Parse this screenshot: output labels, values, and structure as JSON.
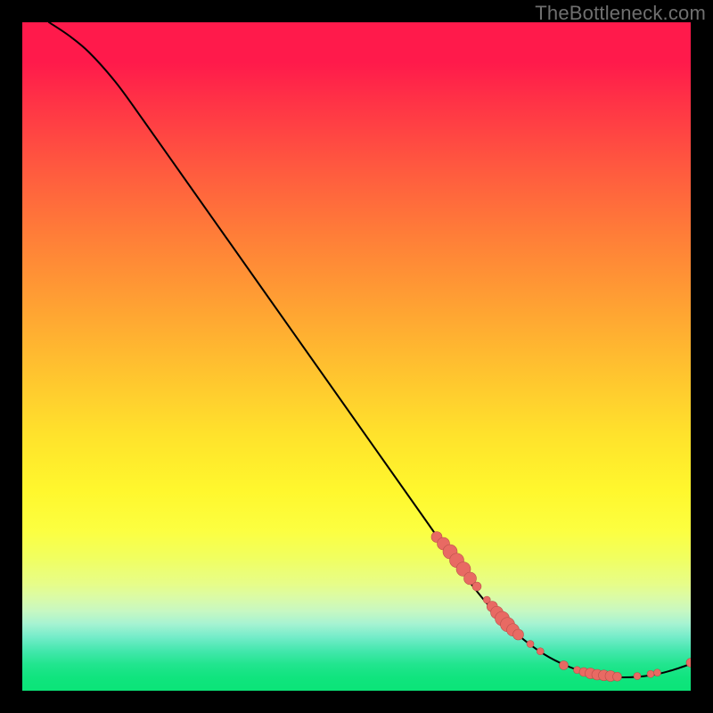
{
  "attribution": "TheBottleneck.com",
  "colors": {
    "marker_fill": "#e86a63",
    "marker_stroke": "#b94e49",
    "curve_stroke": "#000000",
    "gradient_stops": [
      "#ff1a4b",
      "#ff1a4b",
      "#ff3346",
      "#ff5a3f",
      "#ff7e38",
      "#ffa033",
      "#ffc22f",
      "#ffe32c",
      "#fff72d",
      "#fcff40",
      "#f1ff5e",
      "#ecfe74",
      "#e7fd88",
      "#dbfba6",
      "#c8f8c1",
      "#a6f3d2",
      "#73ecc9",
      "#44e7ad",
      "#22e58f",
      "#10e47e",
      "#0be478"
    ]
  },
  "chart_data": {
    "type": "line",
    "title": "",
    "xlabel": "",
    "ylabel": "",
    "xlim": [
      0,
      100
    ],
    "ylim": [
      0,
      100
    ],
    "grid": false,
    "legend": false,
    "curve": [
      {
        "x": 4,
        "y": 100
      },
      {
        "x": 7,
        "y": 98
      },
      {
        "x": 10,
        "y": 95.5
      },
      {
        "x": 14,
        "y": 91
      },
      {
        "x": 18,
        "y": 85.5
      },
      {
        "x": 24,
        "y": 77
      },
      {
        "x": 30,
        "y": 68.5
      },
      {
        "x": 36,
        "y": 60
      },
      {
        "x": 42,
        "y": 51.5
      },
      {
        "x": 48,
        "y": 43
      },
      {
        "x": 54,
        "y": 34.5
      },
      {
        "x": 60,
        "y": 26
      },
      {
        "x": 66,
        "y": 17.5
      },
      {
        "x": 70,
        "y": 12.5
      },
      {
        "x": 74,
        "y": 8.5
      },
      {
        "x": 78,
        "y": 5.5
      },
      {
        "x": 82,
        "y": 3.5
      },
      {
        "x": 86,
        "y": 2.3
      },
      {
        "x": 90,
        "y": 2.0
      },
      {
        "x": 94,
        "y": 2.3
      },
      {
        "x": 97,
        "y": 3.0
      },
      {
        "x": 100,
        "y": 4.0
      }
    ],
    "cluster_markers": [
      {
        "x": 62,
        "y": 23.0,
        "r": 6
      },
      {
        "x": 63,
        "y": 22.0,
        "r": 7
      },
      {
        "x": 64,
        "y": 20.8,
        "r": 8
      },
      {
        "x": 65,
        "y": 19.5,
        "r": 8
      },
      {
        "x": 66,
        "y": 18.2,
        "r": 8
      },
      {
        "x": 67,
        "y": 16.8,
        "r": 7
      },
      {
        "x": 68,
        "y": 15.6,
        "r": 5
      },
      {
        "x": 69.5,
        "y": 13.6,
        "r": 4
      },
      {
        "x": 70.3,
        "y": 12.6,
        "r": 6
      },
      {
        "x": 71.0,
        "y": 11.7,
        "r": 7
      },
      {
        "x": 71.8,
        "y": 10.8,
        "r": 8
      },
      {
        "x": 72.6,
        "y": 9.9,
        "r": 8
      },
      {
        "x": 73.4,
        "y": 9.1,
        "r": 7
      },
      {
        "x": 74.2,
        "y": 8.4,
        "r": 6
      },
      {
        "x": 76.0,
        "y": 7.0,
        "r": 4
      },
      {
        "x": 77.5,
        "y": 5.9,
        "r": 4
      },
      {
        "x": 81.0,
        "y": 3.8,
        "r": 5
      },
      {
        "x": 83.0,
        "y": 3.1,
        "r": 4
      },
      {
        "x": 84.0,
        "y": 2.8,
        "r": 5
      },
      {
        "x": 85.0,
        "y": 2.6,
        "r": 6
      },
      {
        "x": 86.0,
        "y": 2.4,
        "r": 6
      },
      {
        "x": 87.0,
        "y": 2.3,
        "r": 6
      },
      {
        "x": 88.0,
        "y": 2.2,
        "r": 6
      },
      {
        "x": 89.0,
        "y": 2.1,
        "r": 5
      },
      {
        "x": 92.0,
        "y": 2.2,
        "r": 4
      },
      {
        "x": 94.0,
        "y": 2.5,
        "r": 4
      },
      {
        "x": 95.0,
        "y": 2.7,
        "r": 4
      },
      {
        "x": 100.0,
        "y": 4.2,
        "r": 5
      }
    ]
  }
}
